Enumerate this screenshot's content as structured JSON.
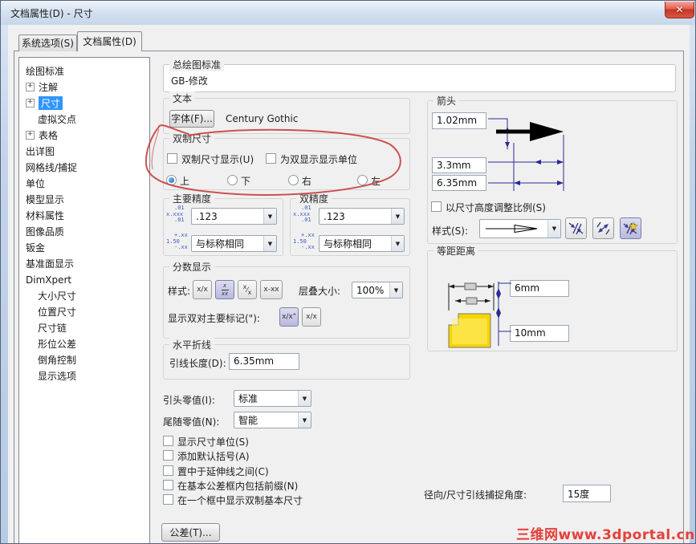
{
  "window": {
    "title": "文档属性(D) - 尺寸"
  },
  "icons": {
    "chevron_down": "▼",
    "close": "✕",
    "plus": "+"
  },
  "tabs": {
    "system": "系统选项(S)",
    "document": "文档属性(D)"
  },
  "tree": {
    "items": [
      "绘图标准",
      "注解",
      "尺寸",
      "虚拟交点",
      "表格",
      "出详图",
      "网格线/捕捉",
      "单位",
      "模型显示",
      "材料属性",
      "图像品质",
      "钣金",
      "基准面显示",
      "DimXpert",
      "大小尺寸",
      "位置尺寸",
      "尺寸链",
      "形位公差",
      "倒角控制",
      "显示选项"
    ]
  },
  "overall_standard": {
    "label": "总绘图标准",
    "value": "GB-修改"
  },
  "text_group": {
    "label": "文本",
    "font_button": "字体(F)...",
    "font_name": "Century Gothic"
  },
  "dual_dim": {
    "label": "双制尺寸",
    "cb_show": "双制尺寸显示(U)",
    "cb_units": "为双显示显示单位",
    "radios": [
      "上",
      "下",
      "右",
      "左"
    ],
    "selected_radio": "上"
  },
  "primary_precision": {
    "label": "主要精度",
    "unit_value": ".123",
    "tol_value": "与标称相同"
  },
  "dual_precision": {
    "label": "双精度",
    "unit_value": ".123",
    "tol_value": "与标称相同"
  },
  "precision_icons": {
    "unit_top": ".01",
    "unit_mid": "x.xxx",
    "unit_bot": ".01",
    "tol_top": "+.xx",
    "tol_mid": "1.50",
    "tol_bot": "-.xx"
  },
  "fraction": {
    "label": "分数显示",
    "style_label": "样式:",
    "btn1": "x/x",
    "btn2_top": "x",
    "btn2_bot": "xx",
    "btn3_top": "x",
    "btn3_slash": "⁄",
    "btn3_bot": "x",
    "btn4": "x-xx",
    "stack_label": "层叠大小:",
    "stack_value": "100%",
    "dual_label": "显示双对主要标记(\"):",
    "dbtn1": "x/x\"",
    "dbtn2": "x/x"
  },
  "bent_leader": {
    "label": "水平折线",
    "leader_label": "引线长度(D):",
    "value": "6.35mm"
  },
  "leading_zero": {
    "label": "引头零值(I):",
    "value": "标准"
  },
  "trailing_zero": {
    "label": "尾随零值(N):",
    "value": "智能"
  },
  "checkboxes": [
    "显示尺寸单位(S)",
    "添加默认括号(A)",
    "置中于延伸线之间(C)",
    "在基本公差框内包括前缀(N)",
    "在一个框中显示双制基本尺寸"
  ],
  "tolerance_button": "公差(T)...",
  "arrows": {
    "label": "箭头",
    "height_value": "1.02mm",
    "width_value": "3.3mm",
    "length_value": "6.35mm",
    "scale_checkbox": "以尺寸高度调整比例(S)",
    "style_label": "样式(S):"
  },
  "offset": {
    "label": "等距距离",
    "value1": "6mm",
    "value2": "10mm"
  },
  "snap": {
    "label": "径向/尺寸引线捕捉角度:",
    "value": "15度"
  },
  "watermark": "三维网www.3dportal.cn"
}
